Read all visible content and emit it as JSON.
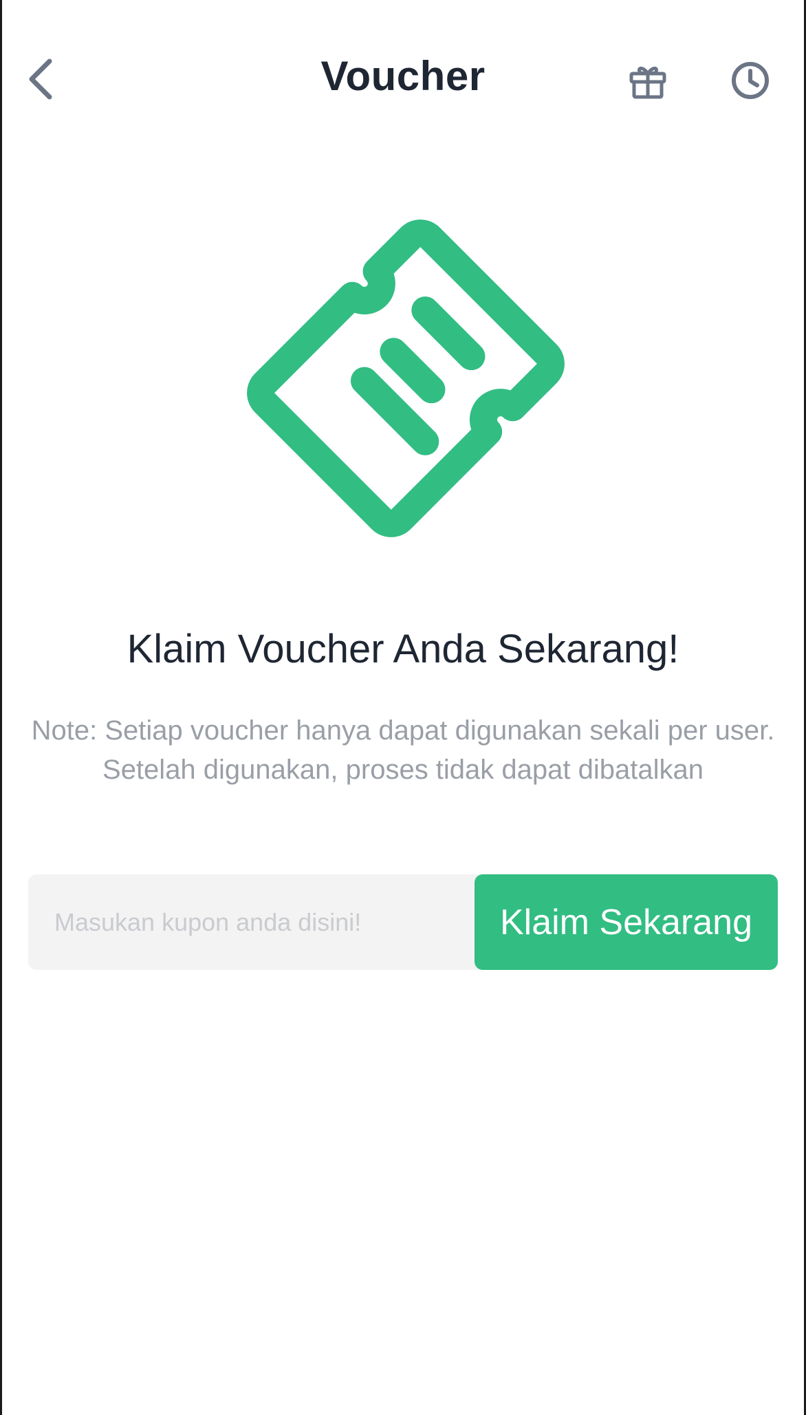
{
  "header": {
    "title": "Voucher",
    "icons": {
      "back": "chevron-left-icon",
      "gift": "gift-icon",
      "history": "clock-icon"
    }
  },
  "hero": {
    "icon": "ticket-icon",
    "color": "#32bd83"
  },
  "main": {
    "headline": "Klaim Voucher Anda Sekarang!",
    "note": "Note: Setiap voucher hanya dapat digunakan sekali per user. Setelah digunakan, proses tidak dapat dibatalkan"
  },
  "form": {
    "coupon_placeholder": "Masukan kupon anda disini!",
    "coupon_value": "",
    "claim_label": "Klaim Sekarang"
  },
  "colors": {
    "accent": "#32bd83",
    "title_text": "#1f2633",
    "muted_text": "#9a9ea6",
    "icon_gray": "#6b7585",
    "input_bg": "#f3f3f3"
  }
}
